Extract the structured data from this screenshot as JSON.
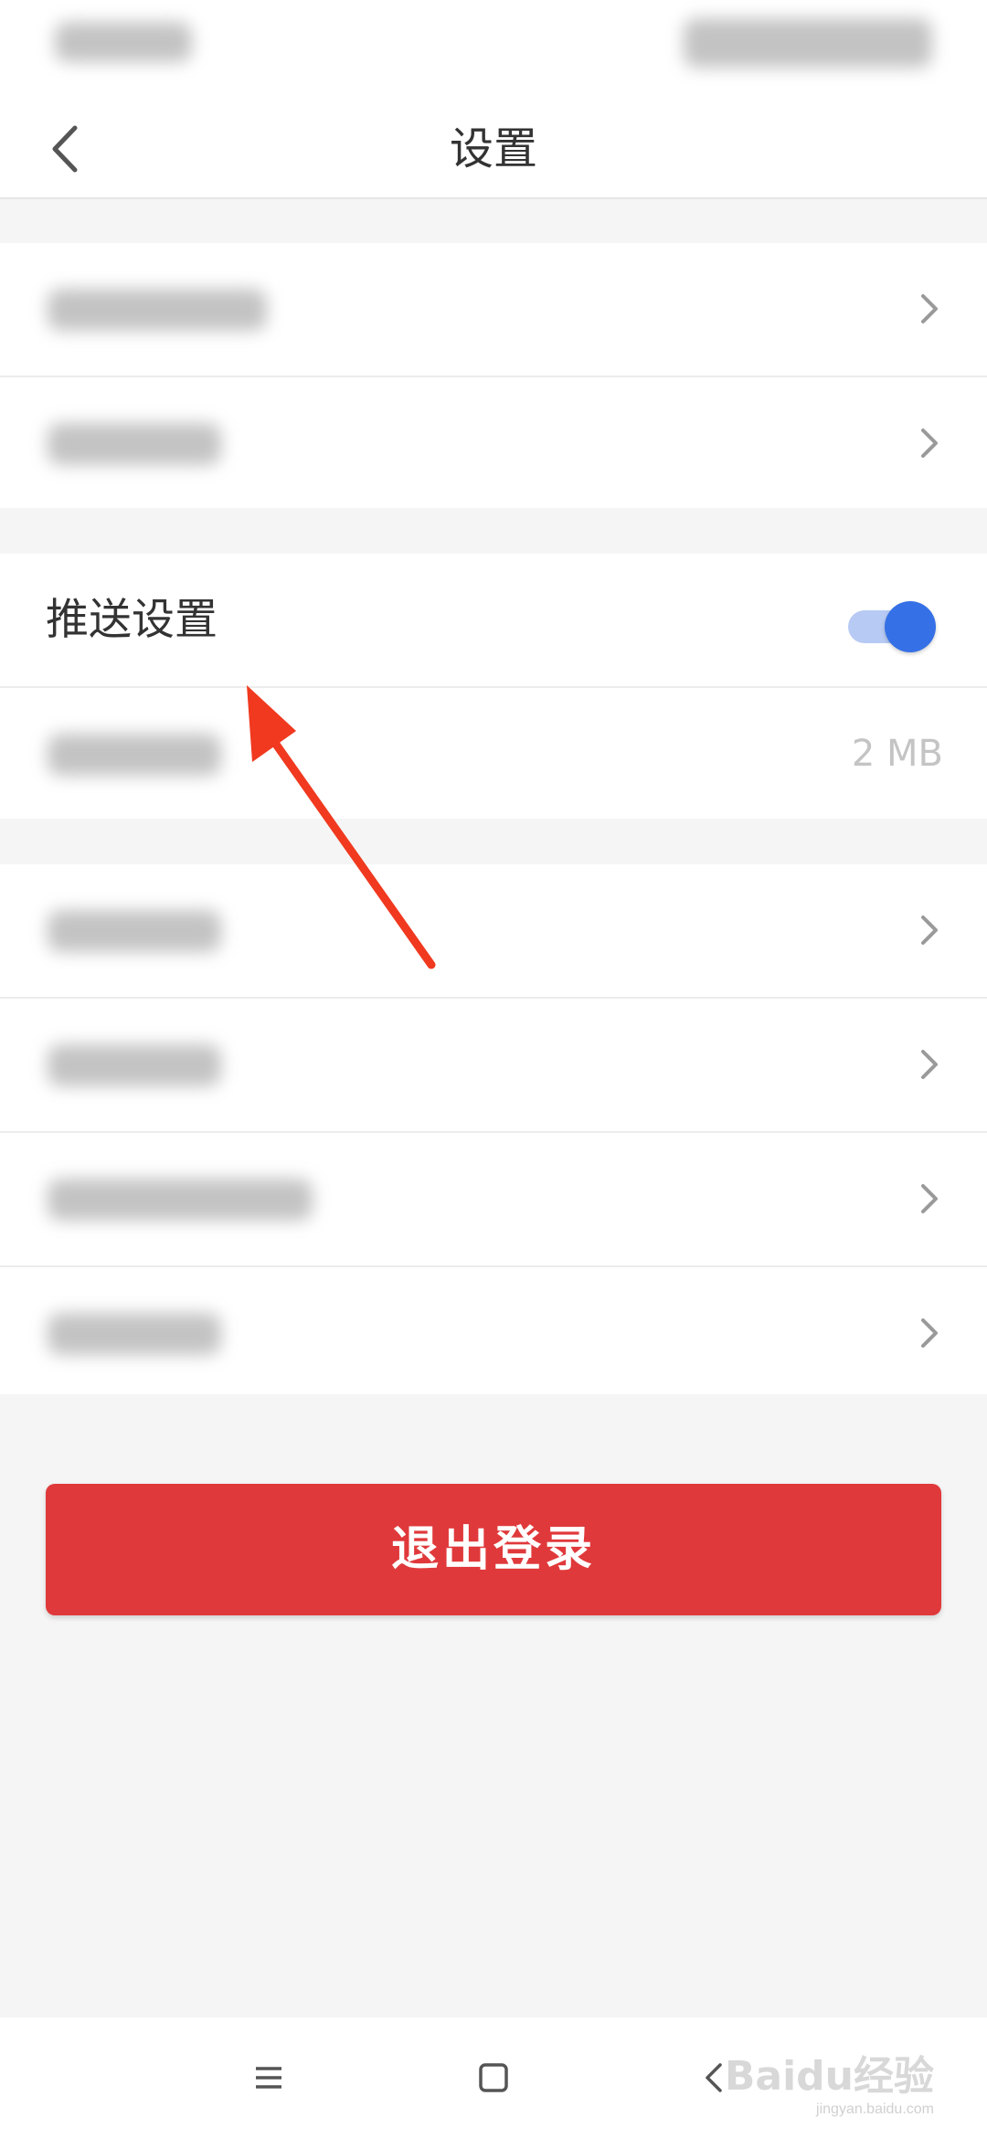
{
  "header": {
    "title": "设置"
  },
  "settings": {
    "push_label": "推送设置",
    "push_enabled": true,
    "cache_value": "2 MB"
  },
  "logout": {
    "label": "退出登录"
  },
  "watermark": {
    "brand": "Baidu经验",
    "url": "jingyan.baidu.com"
  },
  "icons": {
    "back": "chevron-left-icon",
    "row_chevron": "chevron-right-icon",
    "nav_menu": "menu-icon",
    "nav_home": "square-icon",
    "nav_back": "triangle-back-icon"
  },
  "colors": {
    "accent_toggle": "#3570e6",
    "logout_red": "#e0393b",
    "annotation_arrow": "#f0391f"
  }
}
